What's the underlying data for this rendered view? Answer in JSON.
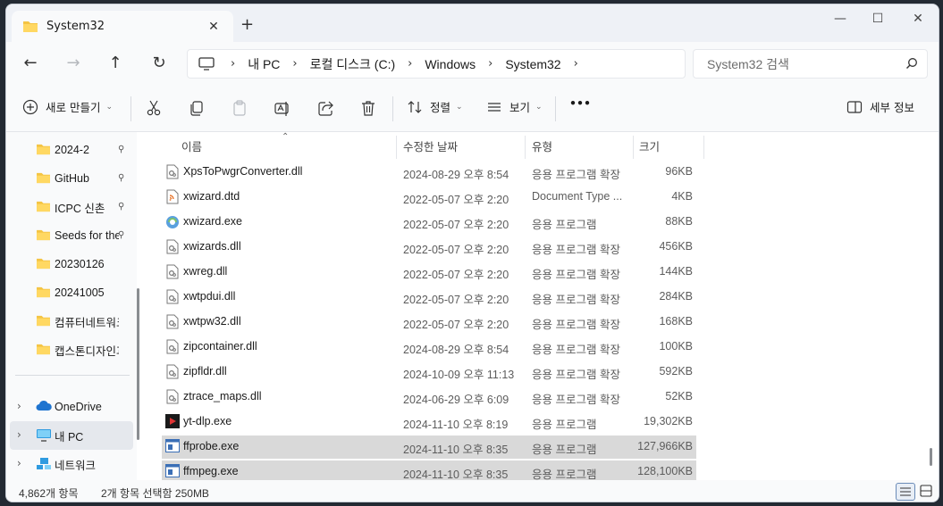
{
  "tab": {
    "title": "System32",
    "close": "✕",
    "new_tab": "+"
  },
  "window_controls": {
    "minimize": "—",
    "maximize": "☐",
    "close": "✕"
  },
  "breadcrumb": [
    "내 PC",
    "로컬 디스크 (C:)",
    "Windows",
    "System32"
  ],
  "search": {
    "placeholder": "System32 검색"
  },
  "commands": {
    "new": "새로 만들기",
    "sort": "정렬",
    "view": "보기",
    "more": "•••",
    "details": "세부 정보"
  },
  "sidebar": {
    "quick_access": [
      {
        "label": "2024-2",
        "pinned": true
      },
      {
        "label": "GitHub",
        "pinned": true
      },
      {
        "label": "ICPC 신촌",
        "pinned": true
      },
      {
        "label": "Seeds for the",
        "pinned": true
      },
      {
        "label": "20230126",
        "pinned": false
      },
      {
        "label": "20241005",
        "pinned": false
      },
      {
        "label": "컴퓨터네트워크",
        "pinned": false
      },
      {
        "label": "캡스톤디자인과",
        "pinned": false
      }
    ],
    "locations": [
      {
        "label": "OneDrive",
        "icon": "cloud-icon"
      },
      {
        "label": "내 PC",
        "icon": "pc-icon",
        "selected": true
      },
      {
        "label": "네트워크",
        "icon": "network-icon"
      }
    ]
  },
  "columns": {
    "name": "이름",
    "date": "수정한 날짜",
    "type": "유형",
    "size": "크기"
  },
  "files": [
    {
      "name": "XpsToPwgrConverter.dll",
      "date": "2024-08-29 오후 8:54",
      "type": "응용 프로그램 확장",
      "size": "96KB",
      "icon": "dll"
    },
    {
      "name": "xwizard.dtd",
      "date": "2022-05-07 오후 2:20",
      "type": "Document Type ...",
      "size": "4KB",
      "icon": "dtd"
    },
    {
      "name": "xwizard.exe",
      "date": "2022-05-07 오후 2:20",
      "type": "응용 프로그램",
      "size": "88KB",
      "icon": "wizard"
    },
    {
      "name": "xwizards.dll",
      "date": "2022-05-07 오후 2:20",
      "type": "응용 프로그램 확장",
      "size": "456KB",
      "icon": "dll"
    },
    {
      "name": "xwreg.dll",
      "date": "2022-05-07 오후 2:20",
      "type": "응용 프로그램 확장",
      "size": "144KB",
      "icon": "dll"
    },
    {
      "name": "xwtpdui.dll",
      "date": "2022-05-07 오후 2:20",
      "type": "응용 프로그램 확장",
      "size": "284KB",
      "icon": "dll"
    },
    {
      "name": "xwtpw32.dll",
      "date": "2022-05-07 오후 2:20",
      "type": "응용 프로그램 확장",
      "size": "168KB",
      "icon": "dll"
    },
    {
      "name": "zipcontainer.dll",
      "date": "2024-08-29 오후 8:54",
      "type": "응용 프로그램 확장",
      "size": "100KB",
      "icon": "dll"
    },
    {
      "name": "zipfldr.dll",
      "date": "2024-10-09 오후 11:13",
      "type": "응용 프로그램 확장",
      "size": "592KB",
      "icon": "dll"
    },
    {
      "name": "ztrace_maps.dll",
      "date": "2024-06-29 오후 6:09",
      "type": "응용 프로그램 확장",
      "size": "52KB",
      "icon": "dll"
    },
    {
      "name": "yt-dlp.exe",
      "date": "2024-11-10 오후 8:19",
      "type": "응용 프로그램",
      "size": "19,302KB",
      "icon": "ytdlp"
    },
    {
      "name": "ffprobe.exe",
      "date": "2024-11-10 오후 8:35",
      "type": "응용 프로그램",
      "size": "127,966KB",
      "icon": "exe",
      "selected": true
    },
    {
      "name": "ffmpeg.exe",
      "date": "2024-11-10 오후 8:35",
      "type": "응용 프로그램",
      "size": "128,100KB",
      "icon": "exe",
      "selected": true
    }
  ],
  "status": {
    "count": "4,862개 항목",
    "selection": "2개 항목 선택함 250MB"
  },
  "colors": {
    "folder": "#f4c443",
    "accent": "#0067c0",
    "selection": "#d9d9d9"
  }
}
